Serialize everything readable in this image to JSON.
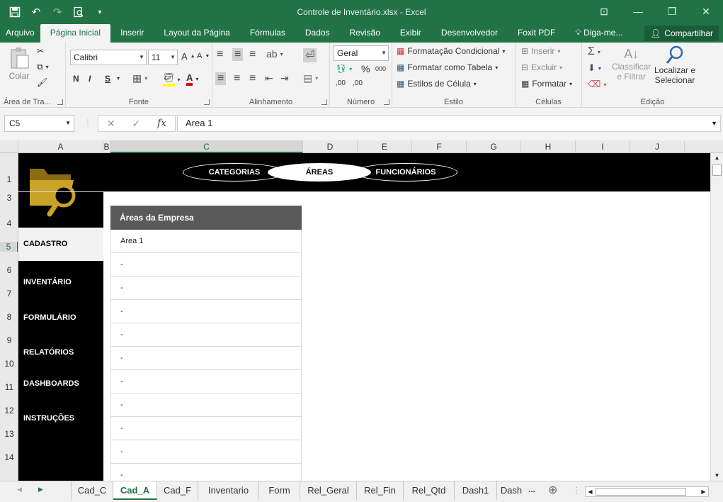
{
  "window": {
    "title": "Controle de Inventário.xlsx - Excel",
    "qat_icons": [
      "save-icon",
      "undo-icon",
      "redo-icon",
      "print-preview-icon",
      "customize-icon"
    ]
  },
  "ribbon_tabs": [
    {
      "label": "Arquivo"
    },
    {
      "label": "Página Inicial"
    },
    {
      "label": "Inserir"
    },
    {
      "label": "Layout da Página"
    },
    {
      "label": "Fórmulas"
    },
    {
      "label": "Dados"
    },
    {
      "label": "Revisão"
    },
    {
      "label": "Exibir"
    },
    {
      "label": "Desenvolvedor"
    },
    {
      "label": "Foxit PDF"
    },
    {
      "label": "Diga-me..."
    }
  ],
  "share_label": "Compartilhar",
  "ribbon": {
    "clipboard": {
      "paste_label": "Colar",
      "group_label": "Área de Tra..."
    },
    "font": {
      "font_name": "Calibri",
      "font_size": "11",
      "bold": "N",
      "italic": "I",
      "underline": "S",
      "group_label": "Fonte"
    },
    "alignment": {
      "group_label": "Alinhamento"
    },
    "number": {
      "format": "Geral",
      "percent": "%",
      "thousands": "000",
      "dec_inc": ",00",
      "dec_dec": ",00",
      "group_label": "Número"
    },
    "styles": {
      "conditional": "Formatação Condicional",
      "as_table": "Formatar como Tabela",
      "cell_styles": "Estilos de Célula",
      "group_label": "Estilo"
    },
    "cells": {
      "insert": "Inserir",
      "delete": "Excluir",
      "format": "Formatar",
      "group_label": "Células"
    },
    "editing": {
      "sort_line1": "Classificar",
      "sort_line2": "e Filtrar",
      "find_line1": "Localizar e",
      "find_line2": "Selecionar",
      "group_label": "Edição"
    }
  },
  "formula_bar": {
    "cell_ref": "C5",
    "fx": "fx",
    "value": "Area 1"
  },
  "columns": [
    "A",
    "B",
    "C",
    "D",
    "E",
    "F",
    "G",
    "H",
    "I",
    "J"
  ],
  "rows": [
    "1",
    "3",
    "4",
    "5",
    "6",
    "7",
    "8",
    "9",
    "10",
    "11",
    "12",
    "13",
    "14"
  ],
  "sheet": {
    "top_nav": [
      {
        "label": "CATEGORIAS",
        "active": false
      },
      {
        "label": "ÁREAS",
        "active": true
      },
      {
        "label": "FUNCIONÁRIOS",
        "active": false
      }
    ],
    "menu": [
      {
        "label": "CADASTRO",
        "active": true
      },
      {
        "label": "INVENTÁRIO",
        "active": false
      },
      {
        "label": "FORMULÁRIO",
        "active": false
      },
      {
        "label": "RELATÓRIOS",
        "active": false
      },
      {
        "label": "DASHBOARDS",
        "active": false
      },
      {
        "label": "INSTRUÇÕES",
        "active": false
      }
    ],
    "table_header": "Áreas da Empresa",
    "table_rows": [
      "Area 1",
      "-",
      "-",
      "-",
      "-",
      "-",
      "-",
      "-",
      "-",
      "-",
      "-"
    ],
    "logo_color": "#c9a227"
  },
  "sheet_tabs": [
    "Cad_C",
    "Cad_A",
    "Cad_F",
    "Inventario",
    "Form",
    "Rel_Geral",
    "Rel_Fin",
    "Rel_Qtd",
    "Dash1",
    "Dash"
  ],
  "active_sheet": "Cad_A",
  "more_tabs": "...",
  "accent": "#217346"
}
